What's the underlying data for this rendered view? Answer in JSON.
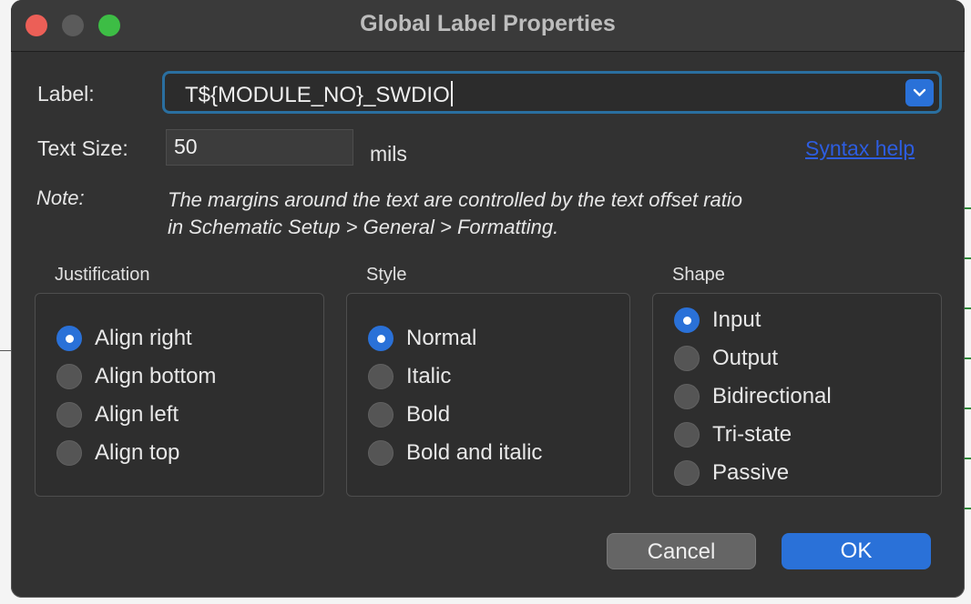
{
  "window": {
    "title": "Global Label Properties"
  },
  "fields": {
    "label_caption": "Label:",
    "label_value": "T${MODULE_NO}_SWDIO",
    "text_size_caption": "Text Size:",
    "text_size_value": "50",
    "text_size_unit": "mils",
    "syntax_help": "Syntax help"
  },
  "note": {
    "caption": "Note:",
    "line1": "The margins around the text are controlled by the text offset ratio",
    "line2": "in Schematic Setup > General > Formatting."
  },
  "justification": {
    "title": "Justification",
    "options": [
      {
        "label": "Align right",
        "checked": true
      },
      {
        "label": "Align bottom",
        "checked": false
      },
      {
        "label": "Align left",
        "checked": false
      },
      {
        "label": "Align top",
        "checked": false
      }
    ]
  },
  "style": {
    "title": "Style",
    "options": [
      {
        "label": "Normal",
        "checked": true
      },
      {
        "label": "Italic",
        "checked": false
      },
      {
        "label": "Bold",
        "checked": false
      },
      {
        "label": "Bold and italic",
        "checked": false
      }
    ]
  },
  "shape": {
    "title": "Shape",
    "options": [
      {
        "label": "Input",
        "checked": true
      },
      {
        "label": "Output",
        "checked": false
      },
      {
        "label": "Bidirectional",
        "checked": false
      },
      {
        "label": "Tri-state",
        "checked": false
      },
      {
        "label": "Passive",
        "checked": false
      }
    ]
  },
  "buttons": {
    "cancel": "Cancel",
    "ok": "OK"
  },
  "colors": {
    "accent": "#2a71d8",
    "window_bg": "#323232",
    "link": "#2d5de0"
  }
}
